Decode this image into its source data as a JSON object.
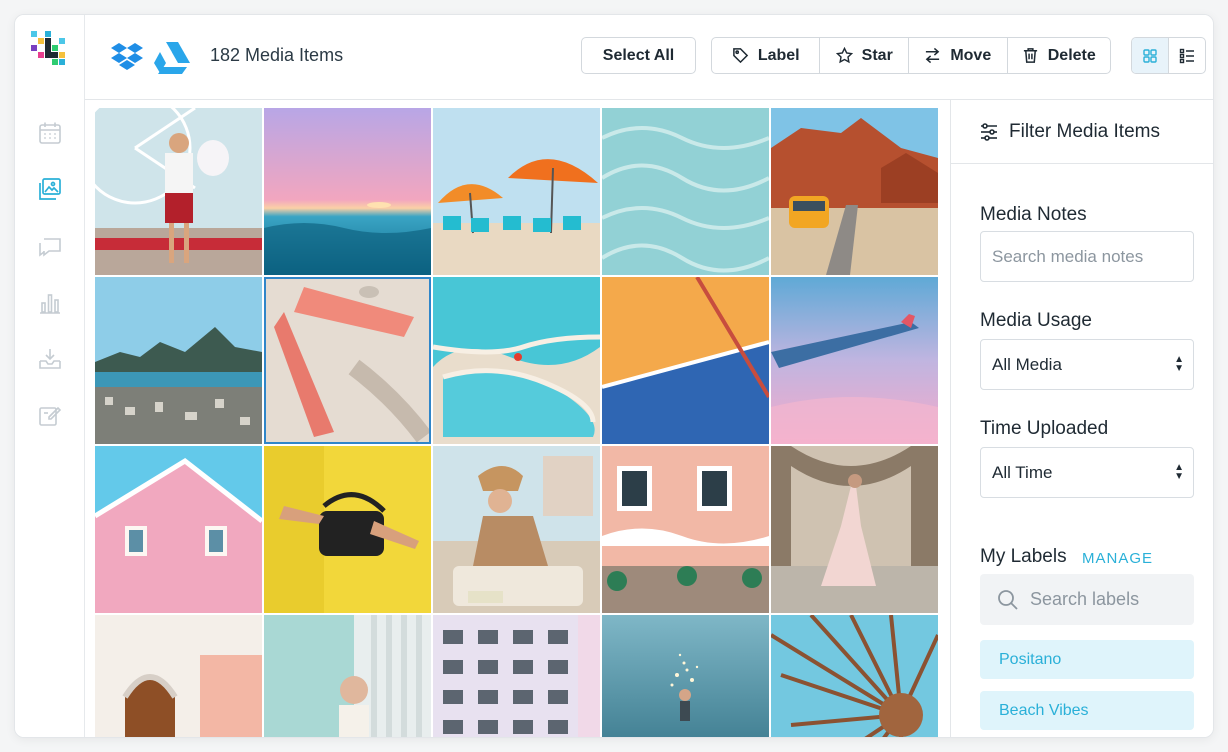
{
  "header": {
    "media_count": "182 Media Items",
    "select_all": "Select All",
    "actions": {
      "label": "Label",
      "star": "Star",
      "move": "Move",
      "delete": "Delete"
    },
    "view_mode": "grid"
  },
  "sidebar": {
    "items": [
      "calendar-icon",
      "gallery-icon",
      "messages-icon",
      "analytics-icon",
      "inbox-download-icon",
      "compose-icon"
    ],
    "active": "gallery-icon"
  },
  "filter": {
    "title": "Filter Media Items",
    "media_notes_label": "Media Notes",
    "media_notes_placeholder": "Search media notes",
    "media_usage_label": "Media Usage",
    "media_usage_value": "All Media",
    "time_uploaded_label": "Time Uploaded",
    "time_uploaded_value": "All Time",
    "labels_heading": "My Labels",
    "manage": "MANAGE",
    "labels_search_placeholder": "Search labels",
    "labels": [
      "Positano",
      "Beach Vibes"
    ]
  },
  "colors": {
    "accent": "#2ab0d8",
    "dropbox": "#1f8ee6",
    "drive": "#2aa6ea",
    "selection": "#2f86c9"
  }
}
